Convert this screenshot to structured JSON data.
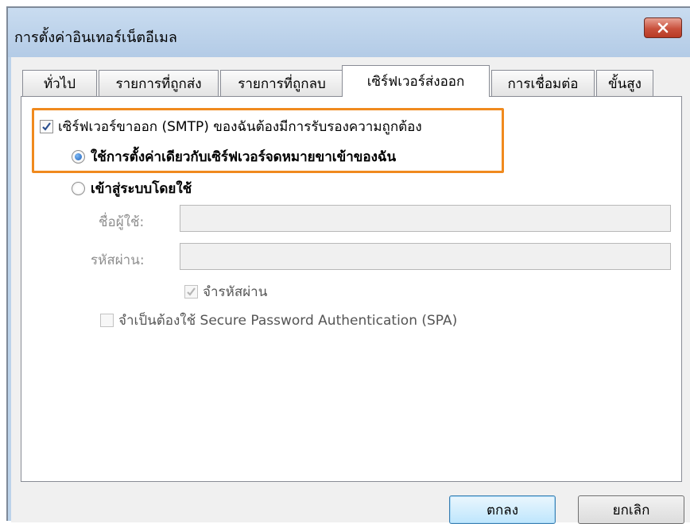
{
  "window": {
    "title": "การตั้งค่าอินเทอร์เน็ตอีเมล"
  },
  "tabs": [
    {
      "label": "ทั่วไป",
      "active": false
    },
    {
      "label": "รายการที่ถูกส่ง",
      "active": false
    },
    {
      "label": "รายการที่ถูกลบ",
      "active": false
    },
    {
      "label": "เซิร์ฟเวอร์ส่งออก",
      "active": true
    },
    {
      "label": "การเชื่อมต่อ",
      "active": false
    },
    {
      "label": "ขั้นสูง",
      "active": false
    }
  ],
  "outgoing": {
    "requires_auth_label": "เซิร์ฟเวอร์ขาออก (SMTP) ของฉันต้องมีการรับรองความถูกต้อง",
    "requires_auth_checked": true,
    "use_same_settings_label": "ใช้การตั้งค่าเดียวกับเซิร์ฟเวอร์จดหมายขาเข้าของฉัน",
    "use_same_settings_selected": true,
    "log_on_using_label": "เข้าสู่ระบบโดยใช้",
    "log_on_using_selected": false,
    "username_label": "ชื่อผู้ใช้:",
    "username_value": "",
    "password_label": "รหัสผ่าน:",
    "password_value": "",
    "remember_password_label": "จำรหัสผ่าน",
    "remember_password_checked": true,
    "spa_label": "จำเป็นต้องใช้ Secure Password Authentication (SPA)",
    "spa_checked": false
  },
  "buttons": {
    "ok_label": "ตกลง",
    "cancel_label": "ยกเลิก"
  },
  "colors": {
    "highlight": "#f08a1e",
    "close_button": "#c9513d"
  }
}
